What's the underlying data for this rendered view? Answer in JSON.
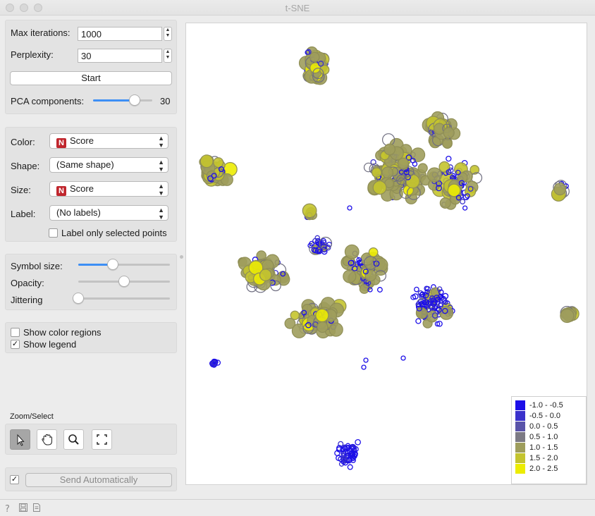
{
  "window": {
    "title": "t-SNE"
  },
  "optimization": {
    "max_iterations_label": "Max iterations:",
    "max_iterations_value": "1000",
    "perplexity_label": "Perplexity:",
    "perplexity_value": "30",
    "start_label": "Start",
    "pca_label": "PCA components:",
    "pca_value": "30",
    "pca_slider_fraction": 0.7
  },
  "attributes": {
    "color_label": "Color:",
    "color_value": "Score",
    "shape_label": "Shape:",
    "shape_value": "(Same shape)",
    "size_label": "Size:",
    "size_value": "Score",
    "label_label": "Label:",
    "label_value": "(No labels)",
    "label_selected_only": "Label only selected points",
    "label_selected_only_checked": false,
    "numeric_badge": "N"
  },
  "visual": {
    "symbol_size_label": "Symbol size:",
    "symbol_size_fraction": 0.38,
    "opacity_label": "Opacity:",
    "opacity_fraction": 0.5,
    "jittering_label": "Jittering",
    "jittering_fraction": 0.0
  },
  "options": {
    "color_regions_label": "Show color regions",
    "color_regions_checked": false,
    "show_legend_label": "Show legend",
    "show_legend_checked": true
  },
  "zoom_select": {
    "title": "Zoom/Select",
    "tools": [
      "pointer-icon",
      "hand-pan-icon",
      "magnifier-zoom-icon",
      "fit-to-view-icon"
    ]
  },
  "send": {
    "auto_checked": true,
    "label": "Send Automatically"
  },
  "legend": {
    "items": [
      {
        "label": "-1.0 - -0.5",
        "color": "#1c0ee8"
      },
      {
        "label": "-0.5 - 0.0",
        "color": "#3a31cc"
      },
      {
        "label": "0.0 - 0.5",
        "color": "#5a54a9"
      },
      {
        "label": "0.5 - 1.0",
        "color": "#7c7a84"
      },
      {
        "label": "1.0 - 1.5",
        "color": "#9e9d5c"
      },
      {
        "label": "1.5 - 2.0",
        "color": "#c4c42e"
      },
      {
        "label": "2.0 - 2.5",
        "color": "#ecec02"
      }
    ]
  },
  "statusbar": {
    "icons": [
      "help-icon",
      "save-icon",
      "report-icon"
    ]
  }
}
